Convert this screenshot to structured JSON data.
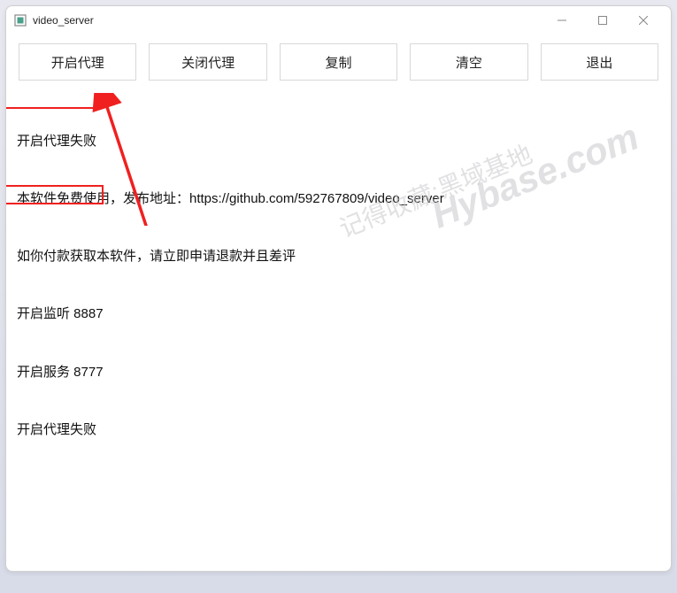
{
  "window": {
    "title": "video_server"
  },
  "toolbar": {
    "start_proxy": "开启代理",
    "stop_proxy": "关闭代理",
    "copy": "复制",
    "clear": "清空",
    "exit": "退出"
  },
  "log": {
    "lines": [
      "开启代理失败",
      "本软件免费使用，发布地址：https://github.com/592767809/video_server",
      "如你付款获取本软件，请立即申请退款并且差评",
      "开启监听 8887",
      "开启服务 8777",
      "开启代理失败"
    ]
  },
  "watermark": {
    "en": "Hybase.com",
    "cn": "记得收藏:黑域基地"
  },
  "annotation": {
    "highlight_indices": [
      0,
      5
    ]
  }
}
